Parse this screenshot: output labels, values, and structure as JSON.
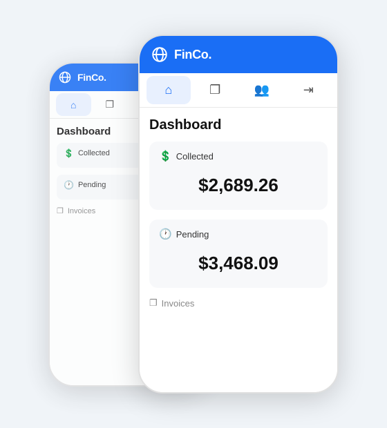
{
  "app": {
    "name": "FinCo.",
    "header_title": "FinCo."
  },
  "nav": {
    "tabs": [
      {
        "id": "home",
        "label": "Home",
        "icon": "⌂",
        "active": true
      },
      {
        "id": "documents",
        "label": "Documents",
        "icon": "❐",
        "active": false
      },
      {
        "id": "users",
        "label": "Users",
        "icon": "👥",
        "active": false
      },
      {
        "id": "logout",
        "label": "Logout",
        "icon": "⇥",
        "active": false
      }
    ]
  },
  "dashboard": {
    "title": "Dashboard",
    "collected": {
      "label": "Collected",
      "value": "$2,689.26"
    },
    "pending": {
      "label": "Pending",
      "value": "$3,468.09"
    },
    "invoices": {
      "label": "Invoices"
    }
  }
}
